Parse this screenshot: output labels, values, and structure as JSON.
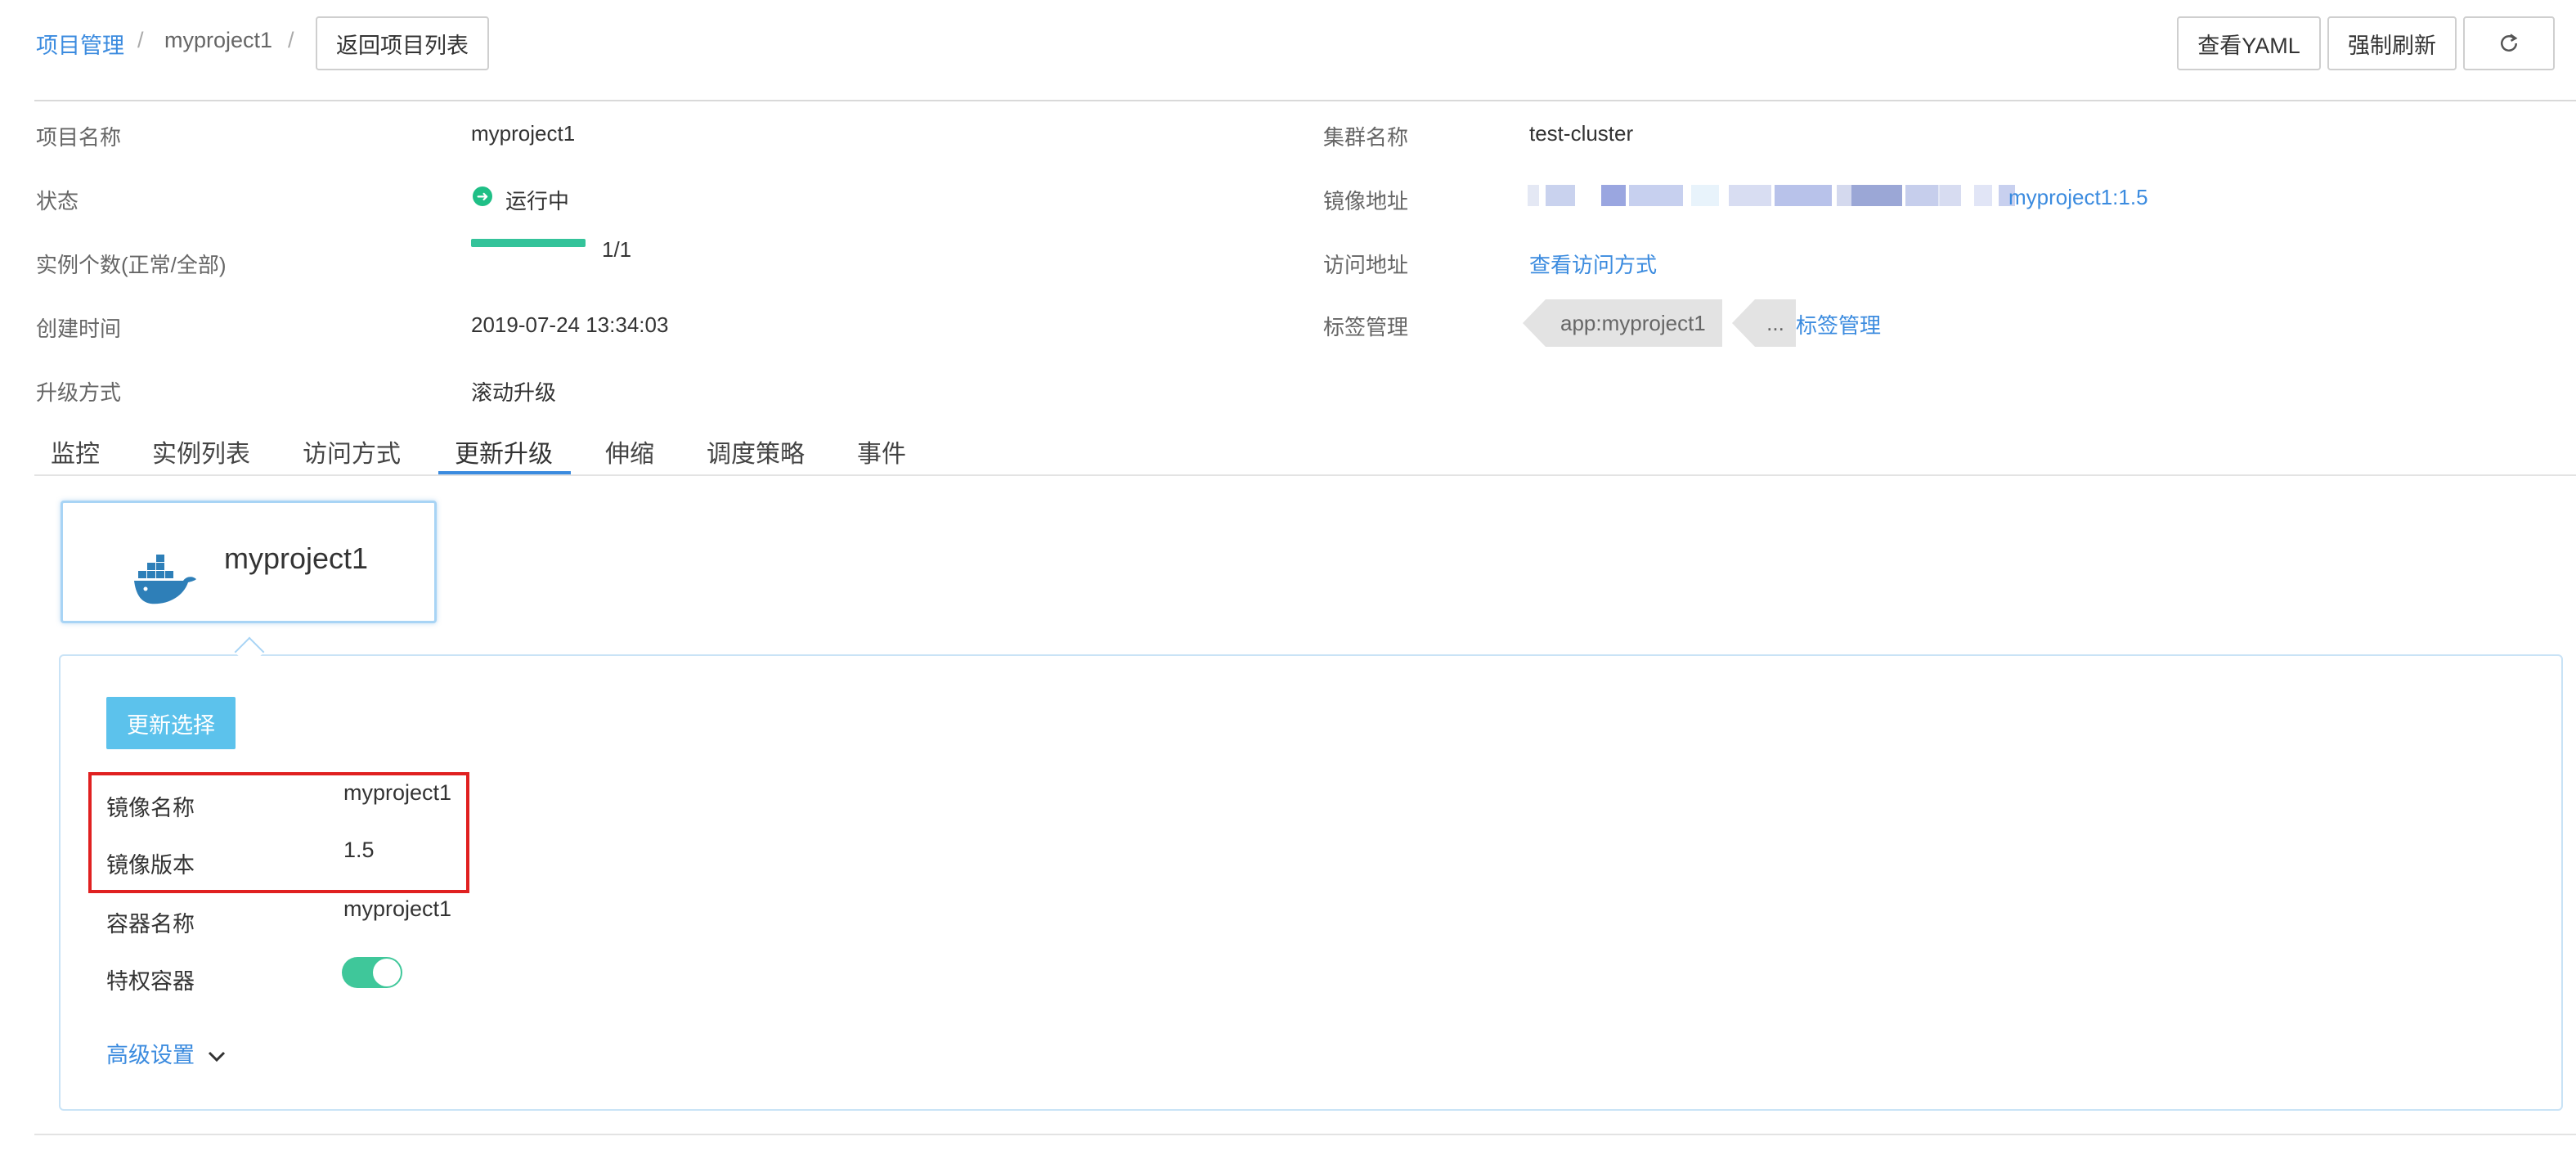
{
  "breadcrumb": {
    "items": [
      "项目管理",
      "myproject1"
    ],
    "separator": "/",
    "back_button": "返回项目列表"
  },
  "header_actions": {
    "view_yaml": "查看YAML",
    "force_refresh": "强制刷新",
    "refresh_icon": "refresh-icon"
  },
  "info": {
    "project_name_label": "项目名称",
    "project_name": "myproject1",
    "status_label": "状态",
    "status": "运行中",
    "instances_label": "实例个数(正常/全部)",
    "instances": "1/1",
    "instances_progress": 1.0,
    "created_label": "创建时间",
    "created": "2019-07-24 13:34:03",
    "upgrade_label": "升级方式",
    "upgrade": "滚动升级",
    "cluster_label": "集群名称",
    "cluster": "test-cluster",
    "image_label": "镜像地址",
    "image_suffix": "myproject1:1.5",
    "access_label": "访问地址",
    "access_link": "查看访问方式",
    "tags_label": "标签管理",
    "tag": "app:myproject1",
    "tag_more": "...",
    "tags_link": "标签管理"
  },
  "tabs": [
    "监控",
    "实例列表",
    "访问方式",
    "更新升级",
    "伸缩",
    "调度策略",
    "事件"
  ],
  "active_tab": "更新升级",
  "container_card": {
    "title": "myproject1",
    "icon": "docker-whale-icon"
  },
  "update_form": {
    "button": "更新选择",
    "image_name_label": "镜像名称",
    "image_name": "myproject1",
    "image_version_label": "镜像版本",
    "image_version": "1.5",
    "container_name_label": "容器名称",
    "container_name": "myproject1",
    "privileged_label": "特权容器",
    "privileged": true,
    "advanced_settings": "高级设置"
  },
  "colors": {
    "link": "#3b8bdf",
    "status_green": "#1fbf86",
    "toggle_on": "#3fc79a",
    "update_button": "#5cc2ec",
    "highlight_box": "#e02020"
  }
}
